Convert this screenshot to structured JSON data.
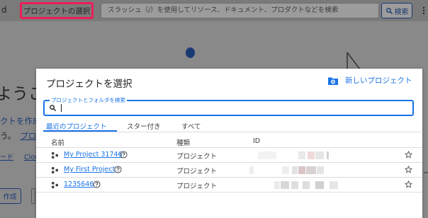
{
  "topbar": {
    "brand_tail": "d",
    "project_button_label": "プロジェクトの選択",
    "search_placeholder": "スラッシュ（/）を使用してリソース、ドキュメント、プロダクトなどを検索",
    "search_button_label": "検索"
  },
  "background": {
    "welcome_text": "ようこ",
    "create_text": "クトを作成",
    "hint_text": "う。",
    "hint_link": "プロ",
    "link_1": "ード",
    "link_2": "Clou",
    "create_button": "作成"
  },
  "dialog": {
    "title": "プロジェクトを選択",
    "new_project_label": "新しいプロジェクト",
    "search_label": "プロジェクトとフォルダを検索",
    "search_value": "",
    "tabs": [
      {
        "label": "最近のプロジェクト",
        "active": true
      },
      {
        "label": "スター付き",
        "active": false
      },
      {
        "label": "すべて",
        "active": false
      }
    ],
    "columns": {
      "name": "名前",
      "type": "種類",
      "id": "ID"
    },
    "projects": [
      {
        "name": "My Project 31746",
        "type": "プロジェクト",
        "id_hidden": true,
        "starred": false
      },
      {
        "name": "My First Project",
        "type": "プロジェクト",
        "id_hidden": true,
        "starred": false
      },
      {
        "name": "1235646",
        "type": "プロジェクト",
        "id_hidden": true,
        "starred": false
      }
    ]
  },
  "colors": {
    "accent": "#1a73e8",
    "highlight": "#ec1e5a",
    "overlay": "#8b8b8b"
  }
}
